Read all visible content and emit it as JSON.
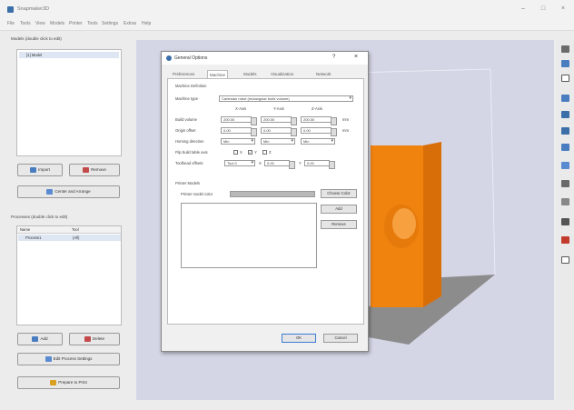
{
  "app": {
    "title": "Snapmaker3D"
  },
  "menu": [
    "File",
    "Tools",
    "View",
    "Models",
    "Printer",
    "Tools",
    "Settings",
    "Extras",
    "Help"
  ],
  "left": {
    "models_label": "Models (double click to edit)",
    "model_items": [
      "[1] Model"
    ],
    "import_label": "Import",
    "remove_label": "Remove",
    "center_label": "Center and Arrange",
    "processes_label": "Processes (double click to edit)",
    "col_name": "Name",
    "col_tool": "Tool",
    "process_row": {
      "name": "Process1",
      "tool": "(All)"
    },
    "add_label": "Add",
    "delete_label": "Delete",
    "edit_settings_label": "Edit Process Settings",
    "prepare_label": "Prepare to Print"
  },
  "dialog": {
    "title": "General Options",
    "help": "?",
    "close": "×",
    "tabs": [
      "Preferences",
      "Machine",
      "Models",
      "Visualization",
      "Network"
    ],
    "active_tab": 1,
    "machine_definition": "Machine Definition",
    "machine_type_label": "Machine type",
    "machine_type_value": "Cartesian robot (rectangular build volume)",
    "x_axis": "X-Axis",
    "y_axis": "Y-Axis",
    "z_axis": "Z-Axis",
    "build_volume_label": "Build volume",
    "build_volume": [
      "200.00",
      "200.00",
      "200.00"
    ],
    "origin_offset_label": "Origin offset",
    "origin_offset": [
      "0.00",
      "0.00",
      "0.00"
    ],
    "homing_label": "Homing direction",
    "homing": [
      "Min",
      "Min",
      "Min"
    ],
    "unit": "mm",
    "flip_label": "Flip build table axis",
    "flip_axes": [
      "X",
      "Y",
      "Z"
    ],
    "toolhead_label": "Toolhead offsets",
    "toolhead": [
      "Tool 0",
      "0.00",
      "0.00"
    ],
    "printer_models": "Printer Models",
    "printer_color_label": "Printer model color",
    "choose_color": "Choose Color",
    "add": "Add",
    "remove": "Remove",
    "ok": "OK",
    "cancel": "Cancel"
  },
  "colors": {
    "model": "#f0820e",
    "bed": "#8c8c8c",
    "viewport": "#d4d6e6"
  }
}
